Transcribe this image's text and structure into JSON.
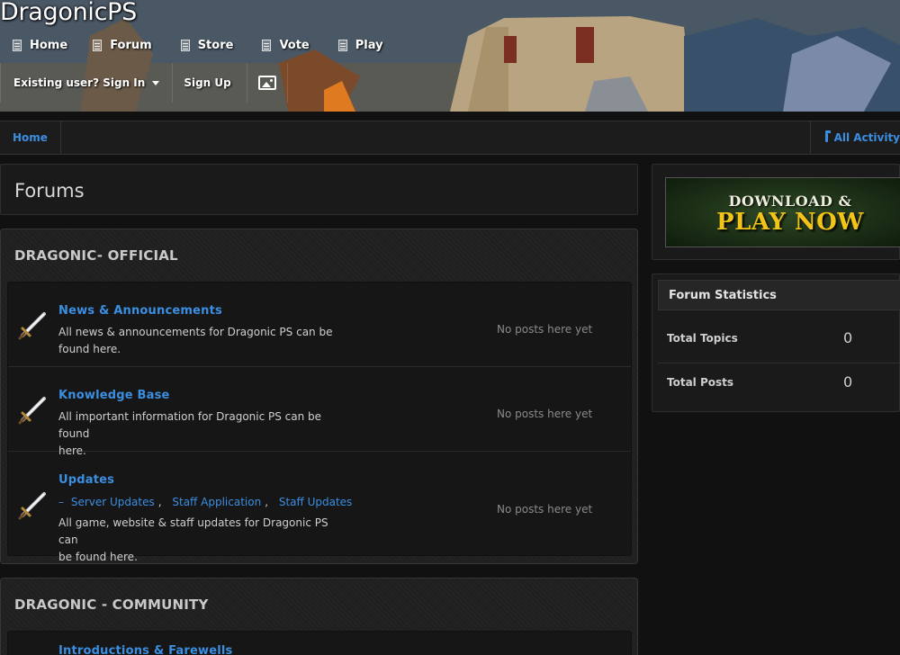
{
  "site": {
    "title": "DragonicPS"
  },
  "nav": [
    {
      "label": "Home",
      "icon": "page-icon"
    },
    {
      "label": "Forum",
      "icon": "page-icon"
    },
    {
      "label": "Store",
      "icon": "page-icon"
    },
    {
      "label": "Vote",
      "icon": "page-icon"
    },
    {
      "label": "Play",
      "icon": "page-icon"
    }
  ],
  "userbar": {
    "sign_in": "Existing user? Sign In",
    "sign_up": "Sign Up",
    "image_icon": "image-icon"
  },
  "breadcrumb": {
    "home": "Home",
    "activity": "All Activity",
    "activity_icon": "folder-open-icon"
  },
  "page": {
    "title": "Forums"
  },
  "categories": [
    {
      "title": "DRAGONIC- OFFICIAL",
      "forums": [
        {
          "name": "News & Announcements",
          "desc_line1": "All news & announcements for Dragonic PS can be",
          "desc_line2": "found here.",
          "last_post": "No posts here yet"
        },
        {
          "name": "Knowledge Base",
          "desc_line1": "All important information for Dragonic PS can be found",
          "desc_line2": "here.",
          "last_post": "No posts here yet"
        },
        {
          "name": "Updates",
          "subforums": [
            "Server Updates",
            "Staff Application",
            "Staff Updates"
          ],
          "subforum_prefix": "–",
          "desc_line1": "All game, website & staff updates for Dragonic PS can",
          "desc_line2": "be found here.",
          "last_post": "No posts here yet"
        }
      ]
    },
    {
      "title": "DRAGONIC - COMMUNITY",
      "forums": [
        {
          "name": "Introductions & Farewells"
        }
      ]
    }
  ],
  "sidebar": {
    "banner": {
      "line1": "DOWNLOAD &",
      "line2": "PLAY NOW"
    },
    "stats": {
      "title": "Forum Statistics",
      "rows": [
        {
          "label": "Total Topics",
          "value": "0"
        },
        {
          "label": "Total Posts",
          "value": "0"
        }
      ]
    }
  },
  "colors": {
    "link": "#3b8ee0",
    "background": "#111111",
    "banner_gold": "#f2c319"
  }
}
